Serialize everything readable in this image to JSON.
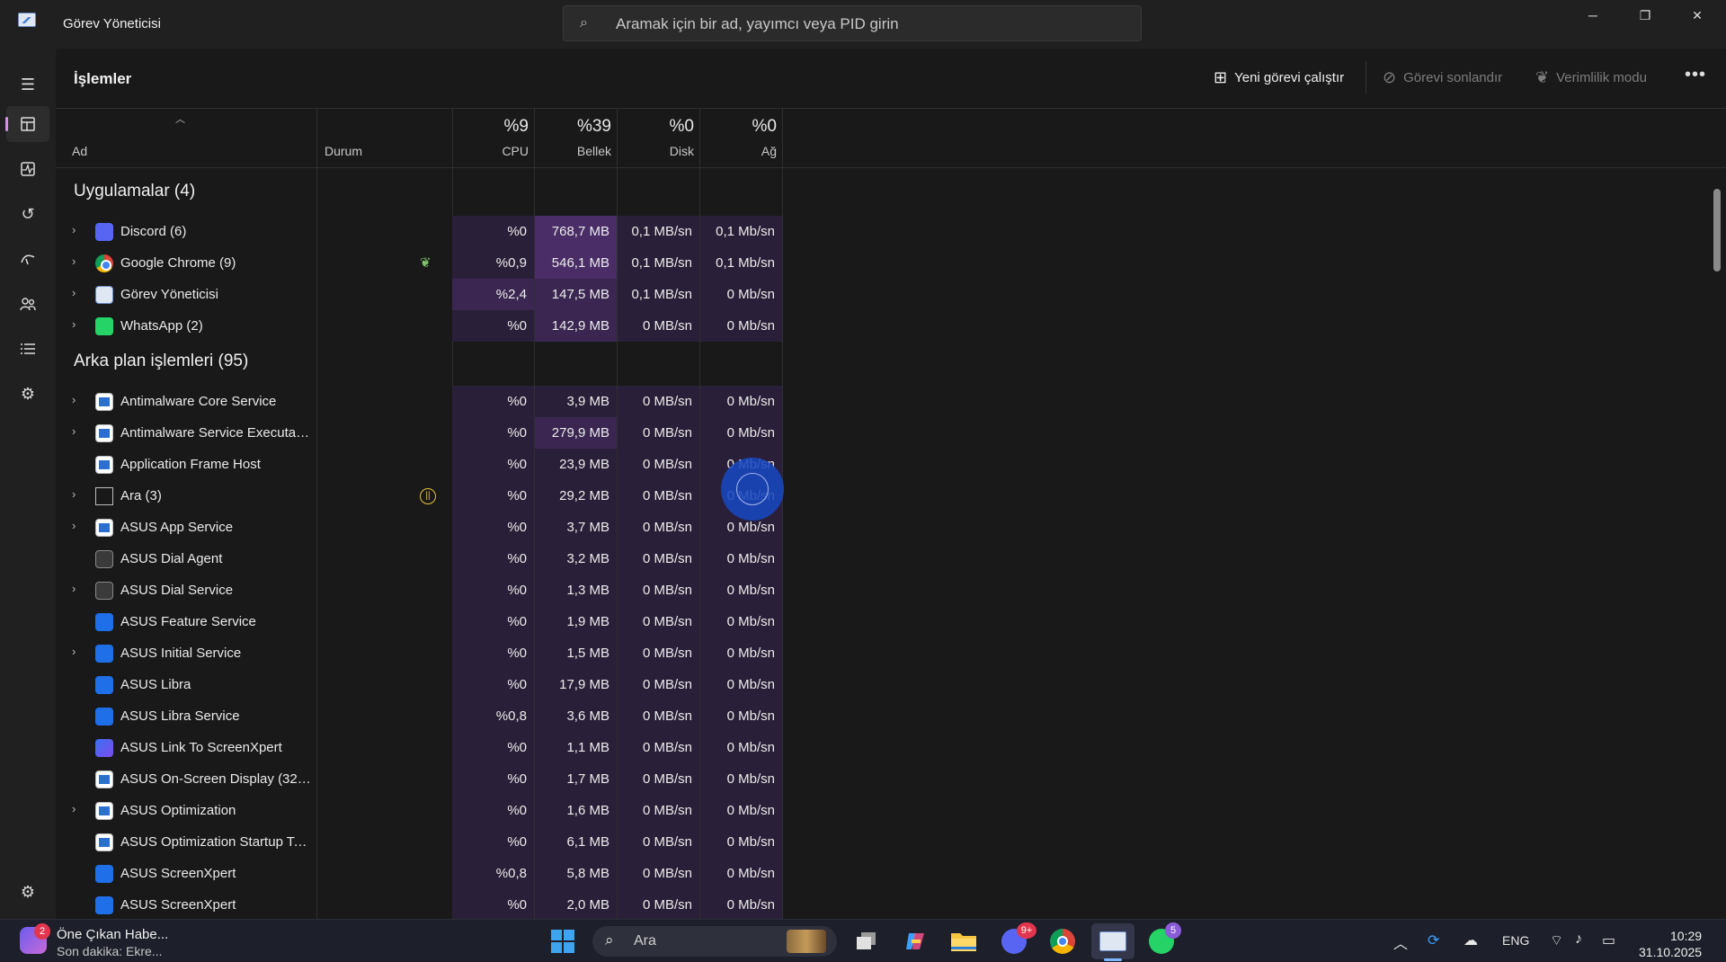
{
  "window": {
    "title": "Görev Yöneticisi",
    "search_placeholder": "Aramak için bir ad, yayımcı veya PID girin",
    "minimize": "─",
    "restore": "❐",
    "close": "✕"
  },
  "nav": [
    "processes",
    "performance",
    "app-history",
    "startup",
    "users",
    "details",
    "services",
    "settings"
  ],
  "page": {
    "title": "İşlemler",
    "run_new_task": "Yeni görevi çalıştır",
    "end_task": "Görevi sonlandır",
    "efficiency_mode": "Verimlilik modu",
    "more": "•••"
  },
  "columns": {
    "name": "Ad",
    "status": "Durum",
    "cpu_pct": "%9",
    "cpu": "CPU",
    "mem_pct": "%39",
    "mem": "Bellek",
    "disk_pct": "%0",
    "disk": "Disk",
    "net_pct": "%0",
    "net": "Ağ"
  },
  "groups": {
    "apps": "Uygulamalar (4)",
    "background": "Arka plan işlemleri (95)"
  },
  "apps": [
    {
      "name": "Discord (6)",
      "icon": "discord",
      "expand": true,
      "status": "",
      "cpu": "%0",
      "mem": "768,7 MB",
      "disk": "0,1 MB/sn",
      "net": "0,1 Mb/sn"
    },
    {
      "name": "Google Chrome (9)",
      "icon": "chrome",
      "expand": true,
      "status": "efficiency-leaf",
      "cpu": "%0,9",
      "mem": "546,1 MB",
      "disk": "0,1 MB/sn",
      "net": "0,1 Mb/sn"
    },
    {
      "name": "Görev Yöneticisi",
      "icon": "taskmgr",
      "expand": true,
      "status": "",
      "cpu": "%2,4",
      "mem": "147,5 MB",
      "disk": "0,1 MB/sn",
      "net": "0 Mb/sn"
    },
    {
      "name": "WhatsApp (2)",
      "icon": "whatsapp",
      "expand": true,
      "status": "",
      "cpu": "%0",
      "mem": "142,9 MB",
      "disk": "0 MB/sn",
      "net": "0 Mb/sn"
    }
  ],
  "background": [
    {
      "name": "Antimalware Core Service",
      "icon": "win",
      "expand": true,
      "status": "",
      "cpu": "%0",
      "mem": "3,9 MB",
      "disk": "0 MB/sn",
      "net": "0 Mb/sn"
    },
    {
      "name": "Antimalware Service Executable",
      "icon": "win",
      "expand": true,
      "status": "",
      "cpu": "%0",
      "mem": "279,9 MB",
      "disk": "0 MB/sn",
      "net": "0 Mb/sn"
    },
    {
      "name": "Application Frame Host",
      "icon": "win",
      "expand": false,
      "status": "",
      "cpu": "%0",
      "mem": "23,9 MB",
      "disk": "0 MB/sn",
      "net": "0 Mb/sn"
    },
    {
      "name": "Ara (3)",
      "icon": "frame",
      "expand": true,
      "status": "paused",
      "cpu": "%0",
      "mem": "29,2 MB",
      "disk": "0 MB/sn",
      "net": "0 Mb/sn"
    },
    {
      "name": "ASUS App Service",
      "icon": "win",
      "expand": true,
      "status": "",
      "cpu": "%0",
      "mem": "3,7 MB",
      "disk": "0 MB/sn",
      "net": "0 Mb/sn"
    },
    {
      "name": "ASUS Dial Agent",
      "icon": "gear",
      "expand": false,
      "status": "",
      "cpu": "%0",
      "mem": "3,2 MB",
      "disk": "0 MB/sn",
      "net": "0 Mb/sn"
    },
    {
      "name": "ASUS Dial Service",
      "icon": "gear",
      "expand": true,
      "status": "",
      "cpu": "%0",
      "mem": "1,3 MB",
      "disk": "0 MB/sn",
      "net": "0 Mb/sn"
    },
    {
      "name": "ASUS Feature Service",
      "icon": "asus",
      "expand": false,
      "status": "",
      "cpu": "%0",
      "mem": "1,9 MB",
      "disk": "0 MB/sn",
      "net": "0 Mb/sn"
    },
    {
      "name": "ASUS Initial Service",
      "icon": "asus",
      "expand": true,
      "status": "",
      "cpu": "%0",
      "mem": "1,5 MB",
      "disk": "0 MB/sn",
      "net": "0 Mb/sn"
    },
    {
      "name": "ASUS Libra",
      "icon": "asus",
      "expand": false,
      "status": "",
      "cpu": "%0",
      "mem": "17,9 MB",
      "disk": "0 MB/sn",
      "net": "0 Mb/sn"
    },
    {
      "name": "ASUS Libra Service",
      "icon": "asus",
      "expand": false,
      "status": "",
      "cpu": "%0,8",
      "mem": "3,6 MB",
      "disk": "0 MB/sn",
      "net": "0 Mb/sn"
    },
    {
      "name": "ASUS Link To ScreenXpert",
      "icon": "asus2",
      "expand": false,
      "status": "",
      "cpu": "%0",
      "mem": "1,1 MB",
      "disk": "0 MB/sn",
      "net": "0 Mb/sn"
    },
    {
      "name": "ASUS On-Screen Display (32 b...",
      "icon": "win",
      "expand": false,
      "status": "",
      "cpu": "%0",
      "mem": "1,7 MB",
      "disk": "0 MB/sn",
      "net": "0 Mb/sn"
    },
    {
      "name": "ASUS Optimization",
      "icon": "win",
      "expand": true,
      "status": "",
      "cpu": "%0",
      "mem": "1,6 MB",
      "disk": "0 MB/sn",
      "net": "0 Mb/sn"
    },
    {
      "name": "ASUS Optimization Startup Task",
      "icon": "win",
      "expand": false,
      "status": "",
      "cpu": "%0",
      "mem": "6,1 MB",
      "disk": "0 MB/sn",
      "net": "0 Mb/sn"
    },
    {
      "name": "ASUS ScreenXpert",
      "icon": "asus",
      "expand": false,
      "status": "",
      "cpu": "%0,8",
      "mem": "5,8 MB",
      "disk": "0 MB/sn",
      "net": "0 Mb/sn"
    },
    {
      "name": "ASUS ScreenXpert",
      "icon": "asus",
      "expand": false,
      "status": "",
      "cpu": "%0",
      "mem": "2,0 MB",
      "disk": "0 MB/sn",
      "net": "0 Mb/sn"
    }
  ],
  "taskbar": {
    "news_badge": "2",
    "news_title": "Öne Çıkan Habe...",
    "news_sub": "Son dakika: Ekre...",
    "search_label": "Ara",
    "discord_badge": "9+",
    "whatsapp_badge": "5",
    "lang": "ENG",
    "time": "10:29",
    "date": "31.10.2025"
  },
  "colors": {
    "accent": "#d68cf0",
    "heat_low": "#2a1f38",
    "heat_mid": "#3a2650",
    "heat_high": "#4a2d66"
  }
}
